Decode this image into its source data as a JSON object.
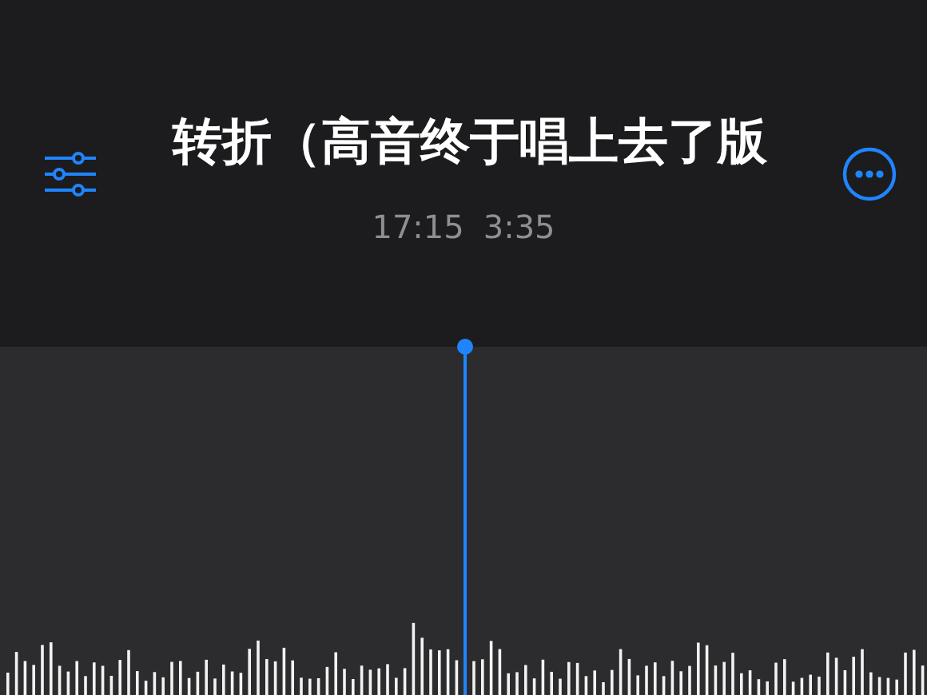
{
  "recording": {
    "title": "转折（高音终于唱上去了版",
    "time": "17:15",
    "duration": "3:35"
  }
}
